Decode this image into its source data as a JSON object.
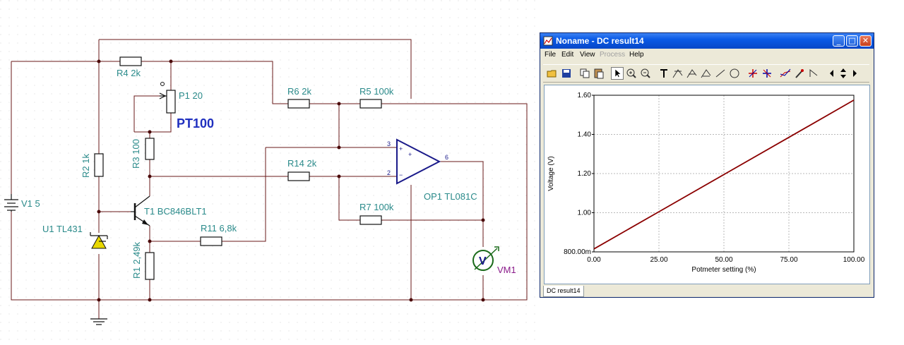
{
  "schematic": {
    "r4": "R4 2k",
    "p1": "P1 20",
    "pt100": "PT100",
    "r6": "R6 2k",
    "r5": "R5 100k",
    "r2": "R2 1k",
    "r3": "R3 100",
    "r14": "R14 2k",
    "v1": "V1 5",
    "t1": "T1 BC846BLT1",
    "u1": "U1 TL431",
    "r11": "R11 6,8k",
    "r7": "R7 100k",
    "op1": "OP1 TL081C",
    "r1": "R1 2,49k",
    "vm1": "VM1",
    "vm_symbol": "V",
    "pin3": "3",
    "pin2": "2",
    "pin6": "6",
    "plus": "+",
    "minus": "−"
  },
  "window": {
    "title": "Noname - DC result14",
    "menu": [
      "File",
      "Edit",
      "View",
      "Process",
      "Help"
    ],
    "menu_disabled": [
      false,
      false,
      false,
      true,
      false
    ],
    "tab": "DC result14",
    "toolbar_icons": [
      "open-icon",
      "save-icon",
      "copy-icon",
      "paste-icon",
      "pointer-icon",
      "zoom-in-icon",
      "zoom-out-icon",
      "text-icon",
      "cursor-a-icon",
      "cursor-b-icon",
      "cursor-c-icon",
      "line-icon",
      "circle-icon",
      "marker-a-icon",
      "marker-b-icon",
      "series-icon",
      "pen-icon",
      "arrow-icon",
      "left-icon",
      "updown-icon",
      "right-icon"
    ],
    "colors": {
      "titlebar": "#0a5ae6",
      "trace": "#8b0000"
    }
  },
  "chart_data": {
    "type": "line",
    "xlabel": "Potmeter setting (%)",
    "ylabel": "Voltage (V)",
    "xlim": [
      0,
      100
    ],
    "ylim": [
      0.8,
      1.6
    ],
    "x_ticks": [
      "0.00",
      "25.00",
      "50.00",
      "75.00",
      "100.00"
    ],
    "y_ticks": [
      "800.00m",
      "1.00",
      "1.20",
      "1.40",
      "1.60"
    ],
    "grid": true,
    "series": [
      {
        "x": [
          0,
          25,
          50,
          75,
          100
        ],
        "y": [
          0.815,
          1.005,
          1.195,
          1.385,
          1.575
        ]
      }
    ]
  }
}
